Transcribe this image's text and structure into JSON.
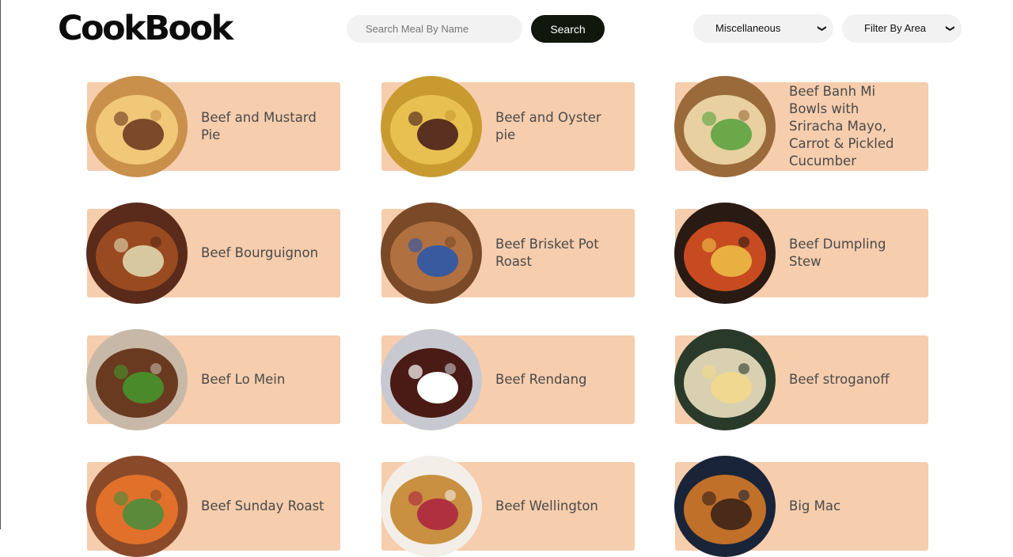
{
  "header": {
    "logo": "CookBook",
    "search_placeholder": "Search Meal By Name",
    "search_button": "Search",
    "category_selected": "Miscellaneous",
    "area_selected": "Filter By Area"
  },
  "meals": [
    {
      "name": "Beef and Mustard Pie",
      "colors": [
        "#c8904a",
        "#f0c878",
        "#7a4a2a"
      ]
    },
    {
      "name": "Beef and Oyster pie",
      "colors": [
        "#c89a30",
        "#e8c050",
        "#5a3020"
      ]
    },
    {
      "name": "Beef Banh Mi Bowls with Sriracha Mayo, Carrot & Pickled Cucumber",
      "colors": [
        "#9a6a3a",
        "#e8d0a0",
        "#6aa84a"
      ]
    },
    {
      "name": "Beef Bourguignon",
      "colors": [
        "#5a2a1a",
        "#9a4a20",
        "#d8c8a0"
      ]
    },
    {
      "name": "Beef Brisket Pot Roast",
      "colors": [
        "#7a4a28",
        "#b07040",
        "#3a5aa0"
      ]
    },
    {
      "name": "Beef Dumpling Stew",
      "colors": [
        "#2a1a14",
        "#c84a20",
        "#e8b040"
      ]
    },
    {
      "name": "Beef Lo Mein",
      "colors": [
        "#c8b8a8",
        "#6a3a20",
        "#4a8a2a"
      ]
    },
    {
      "name": "Beef Rendang",
      "colors": [
        "#c8c8d0",
        "#4a1a14",
        "#ffffff"
      ]
    },
    {
      "name": "Beef stroganoff",
      "colors": [
        "#2a3a2a",
        "#d8d0b0",
        "#f0d890"
      ]
    },
    {
      "name": "Beef Sunday Roast",
      "colors": [
        "#8a4a2a",
        "#e0702a",
        "#5a8a3a"
      ]
    },
    {
      "name": "Beef Wellington",
      "colors": [
        "#f4eee8",
        "#c89040",
        "#b03040"
      ]
    },
    {
      "name": "Big Mac",
      "colors": [
        "#1a2438",
        "#c07028",
        "#4a2a18"
      ]
    }
  ]
}
